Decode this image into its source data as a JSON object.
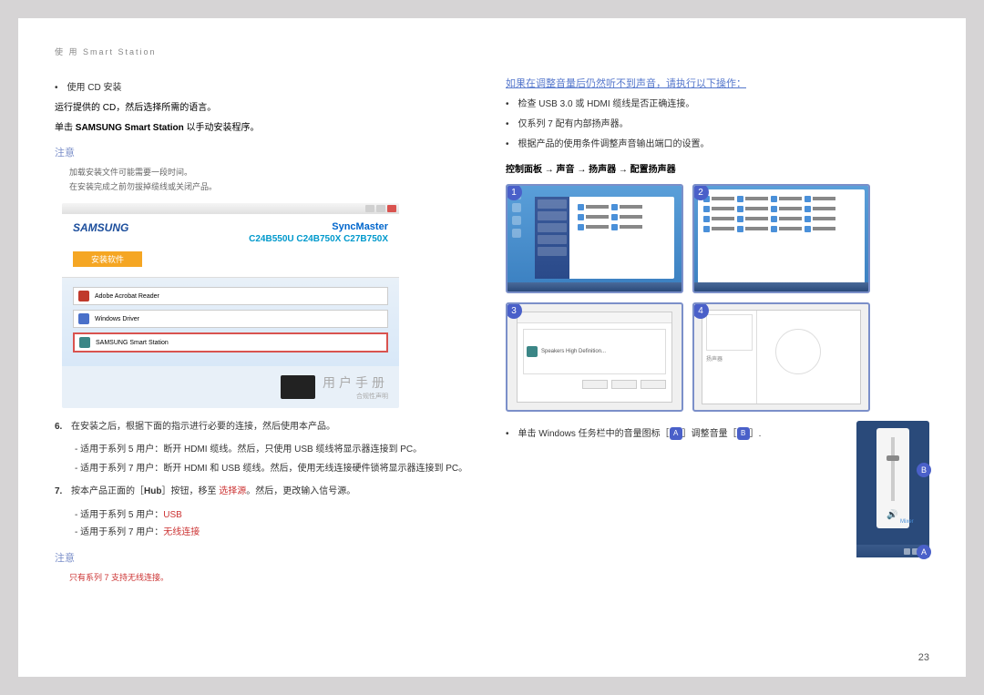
{
  "header": "使 用  Smart Station",
  "left": {
    "b1": {
      "title": "使用 CD 安装",
      "l1": "运行提供的 CD，然后选择所需的语言。",
      "l2_pre": "单击 ",
      "l2_bold": "SAMSUNG Smart Station",
      "l2_post": " 以手动安装程序。"
    },
    "notice_label": "注意",
    "notice1_l1": "加载安装文件可能需要一段时间。",
    "notice1_l2": "在安装完成之前勿拔掉缆线或关闭产品。",
    "scr": {
      "logo": "SAMSUNG",
      "sync": "SyncMaster",
      "models": "C24B550U C24B750X C27B750X",
      "tab": "安装软件",
      "item1": "Adobe Acrobat Reader",
      "item2": "Windows Driver",
      "item3": "SAMSUNG Smart Station",
      "manual": "用户手册",
      "compat": "合规性声明"
    },
    "n6": {
      "num": "6.",
      "text": "在安装之后，根据下面的指示进行必要的连接，然后使用本产品。",
      "s1": "适用于系列 5 用户：断开 HDMI 缆线。然后，只使用 USB 缆线将显示器连接到 PC。",
      "s2": "适用于系列 7 用户：断开 HDMI 和 USB 缆线。然后，使用无线连接硬件锁将显示器连接到 PC。"
    },
    "n7": {
      "num": "7.",
      "t1": "按本产品正面的［",
      "hub": "Hub",
      "t2": "］按钮，移至 ",
      "sel": "选择源",
      "t3": "。然后，更改输入信号源。",
      "s1a": "适用于系列 5 用户：",
      "s1b": "USB",
      "s2a": "适用于系列 7 用户：",
      "s2b": "无线连接"
    },
    "notice2": "只有系列 7 支持无线连接。"
  },
  "right": {
    "heading": "如果在调整音量后仍然听不到声音，请执行以下操作：",
    "b1": "检查 USB 3.0 或 HDMI 缆线是否正确连接。",
    "b2": "仅系列 7 配有内部扬声器。",
    "b3": "根据产品的使用条件调整声音输出端口的设置。",
    "navpath": "控制面板 → 声音 → 扬声器 → 配置扬声器",
    "steps": {
      "1": "1",
      "2": "2",
      "3": "3",
      "4": "4"
    },
    "vol": {
      "t1": "单击 Windows 任务栏中的音量图标［",
      "a": "A",
      "t2": "］调整音量［",
      "b": "B",
      "t3": "］."
    },
    "badges": {
      "a": "A",
      "b": "B"
    }
  },
  "pagenum": "23",
  "chart_data": null
}
